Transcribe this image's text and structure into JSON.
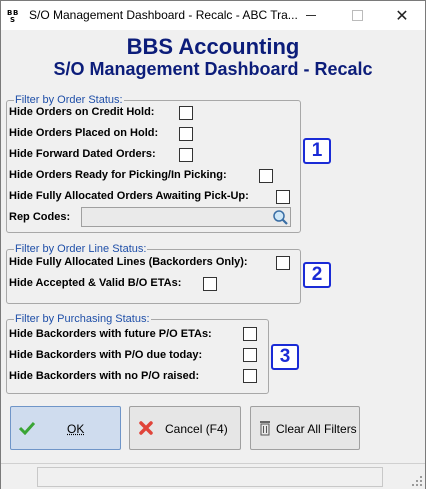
{
  "window": {
    "title": "S/O Management Dashboard - Recalc - ABC Tra..."
  },
  "header": {
    "title": "BBS Accounting",
    "subtitle": "S/O Management Dashboard - Recalc"
  },
  "order_status": {
    "legend": "Filter by Order Status:",
    "options": [
      {
        "label": "Hide Orders on Credit Hold:",
        "checked": false
      },
      {
        "label": "Hide Orders Placed on Hold:",
        "checked": false
      },
      {
        "label": "Hide Forward Dated Orders:",
        "checked": false
      },
      {
        "label": "Hide Orders Ready for Picking/In Picking:",
        "checked": false
      },
      {
        "label": "Hide Fully Allocated Orders Awaiting Pick-Up:",
        "checked": false
      }
    ],
    "rep_codes_label": "Rep Codes:",
    "rep_codes_value": "",
    "badge": "1"
  },
  "order_line_status": {
    "legend": "Filter by Order Line Status:",
    "options": [
      {
        "label": "Hide Fully Allocated Lines (Backorders Only):",
        "checked": false
      },
      {
        "label": "Hide Accepted & Valid B/O ETAs:",
        "checked": false
      }
    ],
    "badge": "2"
  },
  "purchasing_status": {
    "legend": "Filter by Purchasing Status:",
    "options": [
      {
        "label": "Hide Backorders with future P/O ETAs:",
        "checked": false
      },
      {
        "label": "Hide Backorders with P/O due today:",
        "checked": false
      },
      {
        "label": "Hide Backorders with no P/O raised:",
        "checked": false
      }
    ],
    "badge": "3"
  },
  "buttons": {
    "ok": "OK",
    "cancel": "Cancel (F4)",
    "clear": "Clear All Filters"
  },
  "colors": {
    "heading": "#0c1d7a",
    "legend": "#1f4fa8",
    "badge": "#1a2bd6"
  }
}
